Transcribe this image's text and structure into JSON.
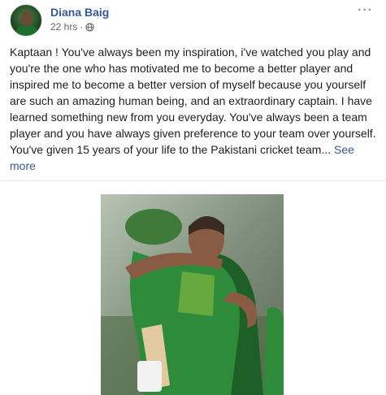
{
  "post": {
    "author": "Diana Baig",
    "timestamp": "22 hrs",
    "separator": "·",
    "privacy_icon": "globe-icon",
    "options_icon": "more-options-icon",
    "text": "Kaptaan ! You've always been my inspiration, i've watched you play and you're the one who has motivated me to become a better player and inspired me to become a better version of myself because you yourself are such an amazing human being, and an extraordinary captain. I have learned something new from you everyday. You've always been a team player and you have always given preference to your team over yourself. You've given 15 years of your life to the Pakistani cricket team...",
    "see_more": "See more"
  },
  "photo": {
    "kit_color": "#2e8b3a",
    "kit_dark": "#1e5e27",
    "accent": "#cfe54a"
  },
  "colors": {
    "link": "#385898",
    "text": "#1c1e21",
    "meta": "#616770"
  }
}
